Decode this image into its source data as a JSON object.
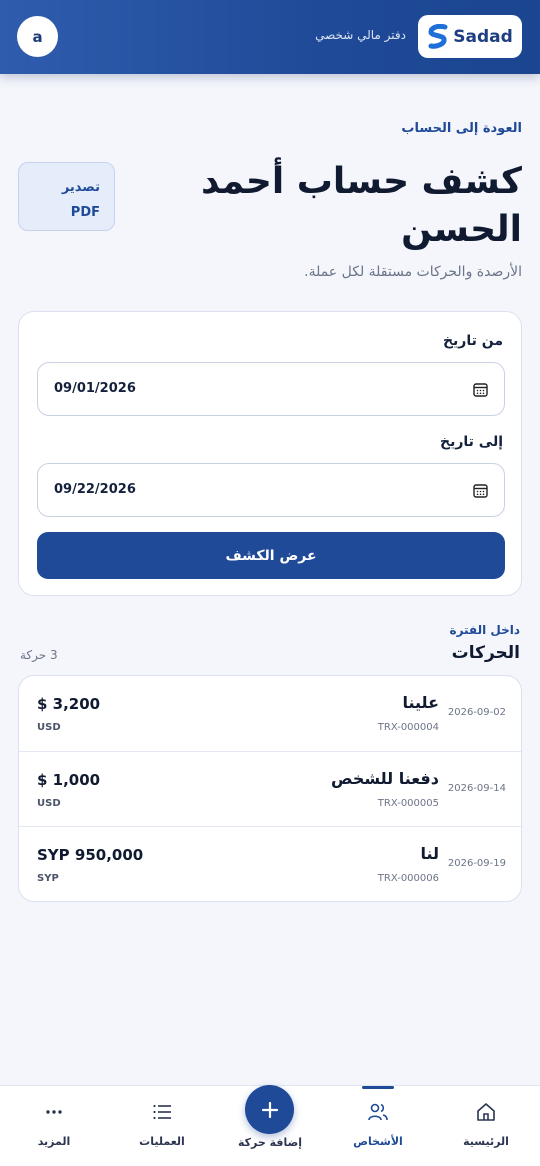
{
  "header": {
    "avatar_letter": "a",
    "subtitle": "دفتر مالي شخصي",
    "logo_text": "Sadad"
  },
  "page": {
    "back_link": "العودة إلى الحساب",
    "title": "كشف حساب أحمد الحسن",
    "export_line1": "تصدير",
    "export_line2": "PDF",
    "description": "الأرصدة والحركات مستقلة لكل عملة."
  },
  "filter": {
    "from_label": "من تاريخ",
    "from_value": "09/01/2026",
    "to_label": "إلى تاريخ",
    "to_value": "09/22/2026",
    "submit_label": "عرض الكشف"
  },
  "transactions": {
    "period_label": "داخل الفترة",
    "title": "الحركات",
    "count": "3 حركة",
    "rows": [
      {
        "amount": "$ 3,200",
        "currency": "USD",
        "name": "علينا",
        "ref": "TRX-000004",
        "date": "2026-09-02"
      },
      {
        "amount": "$ 1,000",
        "currency": "USD",
        "name": "دفعنا للشخص",
        "ref": "TRX-000005",
        "date": "2026-09-14"
      },
      {
        "amount": "SYP 950,000",
        "currency": "SYP",
        "name": "لنا",
        "ref": "TRX-000006",
        "date": "2026-09-19"
      }
    ]
  },
  "nav": {
    "more": "المزيد",
    "operations": "العمليات",
    "add": "إضافة حركة",
    "people": "الأشخاص",
    "home": "الرئيسية"
  },
  "colors": {
    "primary": "#1f4a98",
    "background": "#f4f6fc"
  }
}
